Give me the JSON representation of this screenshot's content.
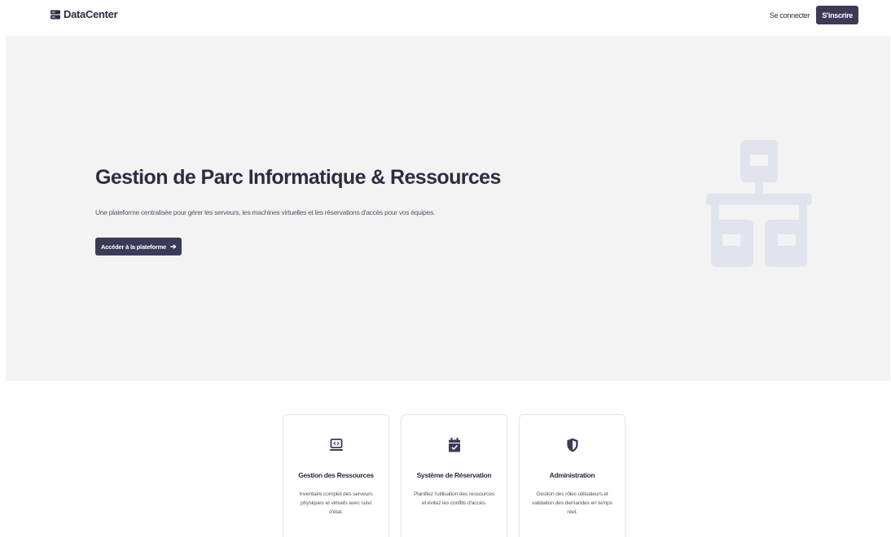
{
  "header": {
    "brand": "DataCenter",
    "login_label": "Se connecter",
    "signup_label": "S'inscrire"
  },
  "hero": {
    "title": "Gestion de Parc Informatique & Ressources",
    "subtitle": "Une plateforme centralisée pour gérer les serveurs, les machines virtuelles et les réservations d'accès pour vos équipes.",
    "cta_label": "Accéder à la plateforme",
    "cta_icon": "arrow-right-icon",
    "illustration_icon": "network-icon"
  },
  "features": [
    {
      "icon": "laptop-code-icon",
      "title": "Gestion des Ressources",
      "description": "Inventaire complet des serveurs physiques et virtuels avec suivi d'état."
    },
    {
      "icon": "calendar-check-icon",
      "title": "Système de Réservation",
      "description": "Planifiez l'utilisation des ressources et évitez les conflits d'accès."
    },
    {
      "icon": "shield-icon",
      "title": "Administration",
      "description": "Gestion des rôles utilisateurs et validation des demandes en temps réel."
    }
  ],
  "colors": {
    "primary": "#3b3b58",
    "text": "#2b2d42",
    "hero_bg": "#f3f3f3",
    "illustration": "#e1e4ec"
  }
}
